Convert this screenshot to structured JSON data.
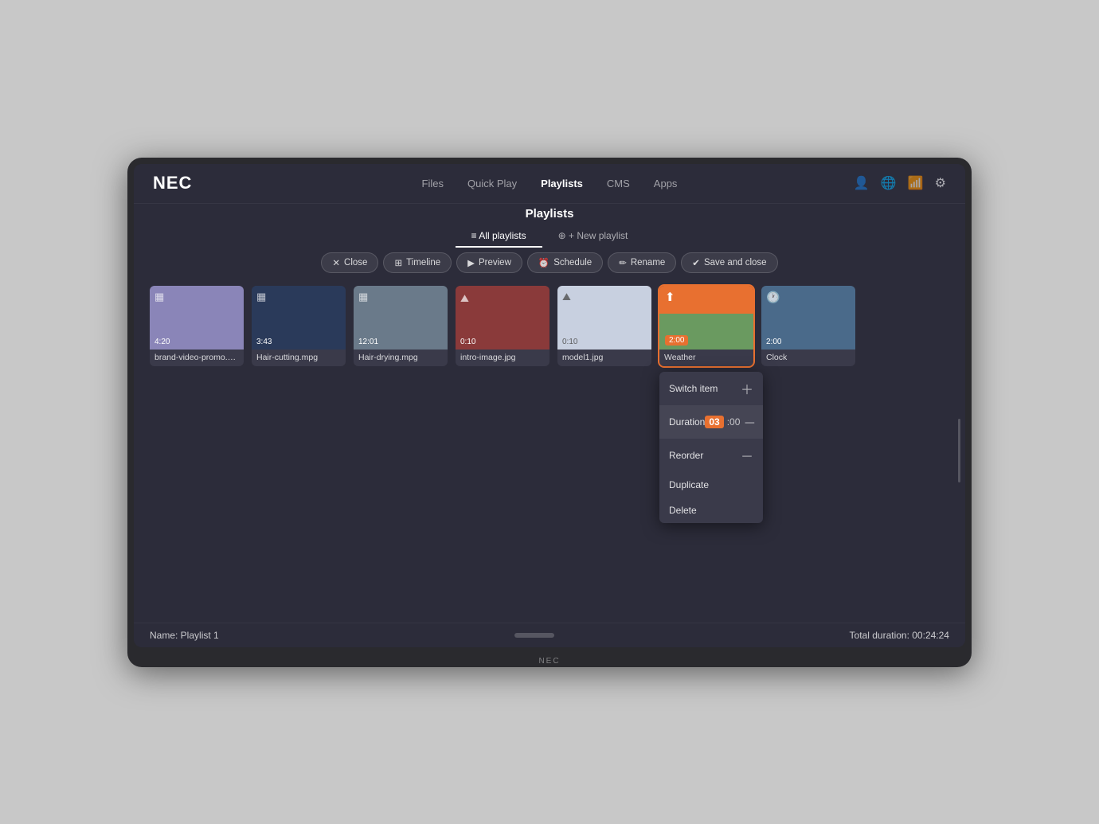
{
  "app": {
    "logo": "NEC",
    "bottom_label": "NEC"
  },
  "nav": {
    "links": [
      {
        "label": "Files",
        "active": false
      },
      {
        "label": "Quick Play",
        "active": false
      },
      {
        "label": "Playlists",
        "active": true
      },
      {
        "label": "CMS",
        "active": false
      },
      {
        "label": "Apps",
        "active": false
      }
    ]
  },
  "playlists": {
    "title": "Playlists",
    "tab_all": "All playlists",
    "tab_new": "+ New playlist"
  },
  "toolbar": {
    "close": "Close",
    "timeline": "Timeline",
    "preview": "Preview",
    "schedule": "Schedule",
    "rename": "Rename",
    "save_and_close": "Save and close"
  },
  "media_items": [
    {
      "id": 1,
      "thumb_class": "thumb-1",
      "icon": "▦",
      "duration": "4:20",
      "label": "brand-video-promo.mpg",
      "type": "video"
    },
    {
      "id": 2,
      "thumb_class": "thumb-2",
      "icon": "▦",
      "duration": "3:43",
      "label": "Hair-cutting.mpg",
      "type": "video"
    },
    {
      "id": 3,
      "thumb_class": "thumb-3",
      "icon": "▦",
      "duration": "12:01",
      "label": "Hair-drying.mpg",
      "type": "video"
    },
    {
      "id": 4,
      "thumb_class": "thumb-4",
      "icon": "⛰",
      "duration": "0:10",
      "label": "intro-image.jpg",
      "type": "image"
    },
    {
      "id": 5,
      "thumb_class": "thumb-5",
      "icon": "⛰",
      "duration": "0:10",
      "label": "model1.jpg",
      "type": "image"
    },
    {
      "id": 6,
      "thumb_class": "weather",
      "icon": "⬆",
      "duration": "2:00",
      "label": "Weather",
      "type": "weather",
      "active": true
    },
    {
      "id": 7,
      "thumb_class": "thumb-7",
      "icon": "🕐",
      "duration": "2:00",
      "label": "Clock",
      "type": "clock"
    }
  ],
  "context_menu": {
    "items": [
      {
        "label": "Switch item",
        "action": "switch",
        "icon": "plus"
      },
      {
        "label": "Duration",
        "action": "duration",
        "icon": "minus",
        "value_highlight": "03",
        "value_rest": ":00"
      },
      {
        "label": "Reorder",
        "action": "reorder",
        "icon": "minus"
      },
      {
        "label": "Duplicate",
        "action": "duplicate"
      },
      {
        "label": "Delete",
        "action": "delete"
      }
    ]
  },
  "bottom": {
    "name_label": "Name: Playlist 1",
    "total_label": "Total duration: 00:24:24"
  }
}
